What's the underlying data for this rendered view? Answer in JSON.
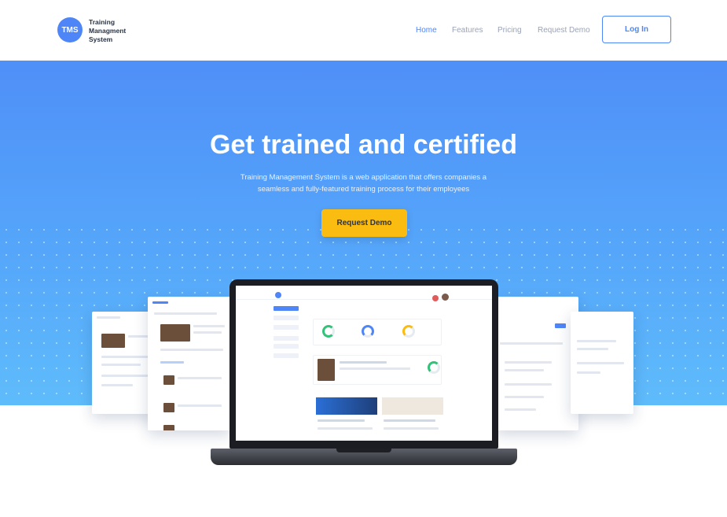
{
  "header": {
    "logo_text": "TMS",
    "brand_name": "Training Managment System",
    "nav": [
      {
        "label": "Home",
        "active": true
      },
      {
        "label": "Features",
        "active": false
      },
      {
        "label": "Pricing",
        "active": false
      },
      {
        "label": "Request Demo",
        "active": false
      }
    ],
    "login_label": "Log In"
  },
  "hero": {
    "title": "Get trained and certified",
    "subtitle": "Training Management System is a web application that offers companies a seamless and fully-featured training process for their employees",
    "cta_label": "Request Demo"
  },
  "colors": {
    "accent": "#4f86f7",
    "cta": "#fbbc11",
    "text_dark": "#2b3445",
    "hero_top": "#4f8ff8",
    "hero_bottom": "#5fbcfb"
  }
}
